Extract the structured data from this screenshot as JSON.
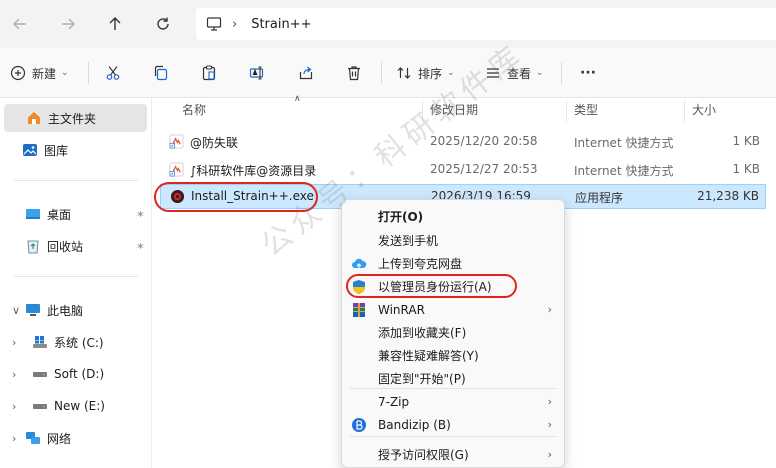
{
  "address_bar": {
    "crumb": "Strain++"
  },
  "toolbar": {
    "new_label": "新建",
    "sort_label": "排序",
    "view_label": "查看",
    "more_label": "···"
  },
  "sidebar": {
    "items": [
      {
        "label": "主文件夹"
      },
      {
        "label": "图库"
      },
      {
        "label": "桌面"
      },
      {
        "label": "回收站"
      },
      {
        "label": "此电脑"
      },
      {
        "label": "系统 (C:)"
      },
      {
        "label": "Soft (D:)"
      },
      {
        "label": "New (E:)"
      },
      {
        "label": "网络"
      }
    ]
  },
  "columns": {
    "name": "名称",
    "modified": "修改日期",
    "type": "类型",
    "size": "大小"
  },
  "files": [
    {
      "name": "@防失联",
      "modified": "2025/12/20 20:58",
      "type": "Internet 快捷方式",
      "size": "1 KB"
    },
    {
      "name": "∫科研软件库@资源目录",
      "modified": "2025/12/27 20:53",
      "type": "Internet 快捷方式",
      "size": "1 KB"
    },
    {
      "name": "Install_Strain++.exe",
      "modified": "2026/3/19 16:59",
      "type": "应用程序",
      "size": "21,238 KB"
    }
  ],
  "context_menu": [
    {
      "label": "打开(O)"
    },
    {
      "label": "发送到手机"
    },
    {
      "label": "上传到夸克网盘"
    },
    {
      "label": "以管理员身份运行(A)"
    },
    {
      "label": "WinRAR"
    },
    {
      "label": "添加到收藏夹(F)"
    },
    {
      "label": "兼容性疑难解答(Y)"
    },
    {
      "label": "固定到\"开始\"(P)"
    },
    {
      "label": "7-Zip"
    },
    {
      "label": "Bandizip (B)"
    },
    {
      "label": "授予访问权限(G)"
    }
  ],
  "watermark": "公众号：科研软件库",
  "colors": {
    "highlight": "#e3241b",
    "selection": "#cce8ff",
    "accent": "#0067c0"
  }
}
